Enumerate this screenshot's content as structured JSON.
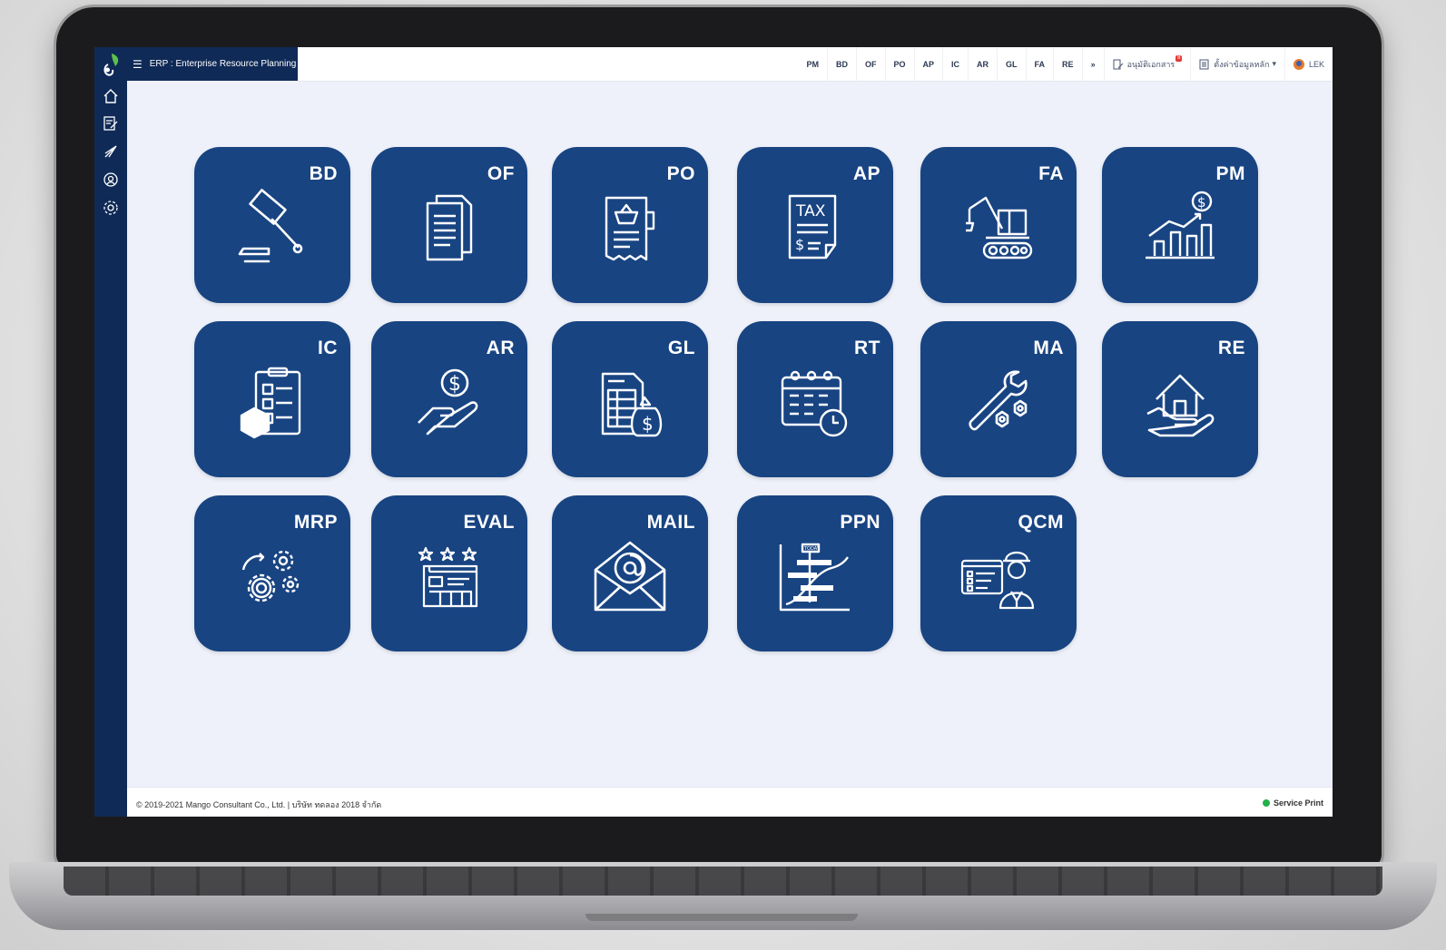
{
  "app": {
    "title": "ERP : Enterprise Resource Planning"
  },
  "topnav": {
    "modules": [
      "PM",
      "BD",
      "OF",
      "PO",
      "AP",
      "IC",
      "AR",
      "GL",
      "FA",
      "RE"
    ],
    "more_icon": "double-chevron-down-icon",
    "approve_docs": {
      "label": "อนุมัติเอกสาร",
      "badge": "8"
    },
    "master_data": {
      "label": "ตั้งค่าข้อมูลหลัก"
    },
    "user": {
      "name": "LEK"
    }
  },
  "sidebar": {
    "icons": [
      "home-icon",
      "document-edit-icon",
      "rocket-icon",
      "support-icon",
      "gear-icon"
    ]
  },
  "tiles": [
    {
      "code": "BD",
      "icon": "gavel-icon"
    },
    {
      "code": "OF",
      "icon": "documents-icon"
    },
    {
      "code": "PO",
      "icon": "purchase-order-icon"
    },
    {
      "code": "AP",
      "icon": "tax-invoice-icon"
    },
    {
      "code": "FA",
      "icon": "excavator-icon"
    },
    {
      "code": "PM",
      "icon": "growth-chart-icon"
    },
    {
      "code": "IC",
      "icon": "inventory-clipboard-icon"
    },
    {
      "code": "AR",
      "icon": "hand-coin-icon"
    },
    {
      "code": "GL",
      "icon": "ledger-moneybag-icon"
    },
    {
      "code": "RT",
      "icon": "calendar-clock-icon"
    },
    {
      "code": "MA",
      "icon": "wrench-icon"
    },
    {
      "code": "RE",
      "icon": "house-hand-icon"
    },
    {
      "code": "MRP",
      "icon": "gears-icon"
    },
    {
      "code": "EVAL",
      "icon": "rating-form-icon"
    },
    {
      "code": "MAIL",
      "icon": "mail-icon"
    },
    {
      "code": "PPN",
      "icon": "gantt-chart-icon"
    },
    {
      "code": "QCM",
      "icon": "quality-engineer-icon"
    }
  ],
  "footer": {
    "copyright": "© 2019-2021 Mango Consultant Co., Ltd. | บริษัท ทดลอง 2018 จำกัด",
    "service": "Service Print",
    "service_status_color": "#23b04a"
  },
  "colors": {
    "sidebar": "#0f2a57",
    "tile": "#184482",
    "background": "#eef1f9"
  }
}
